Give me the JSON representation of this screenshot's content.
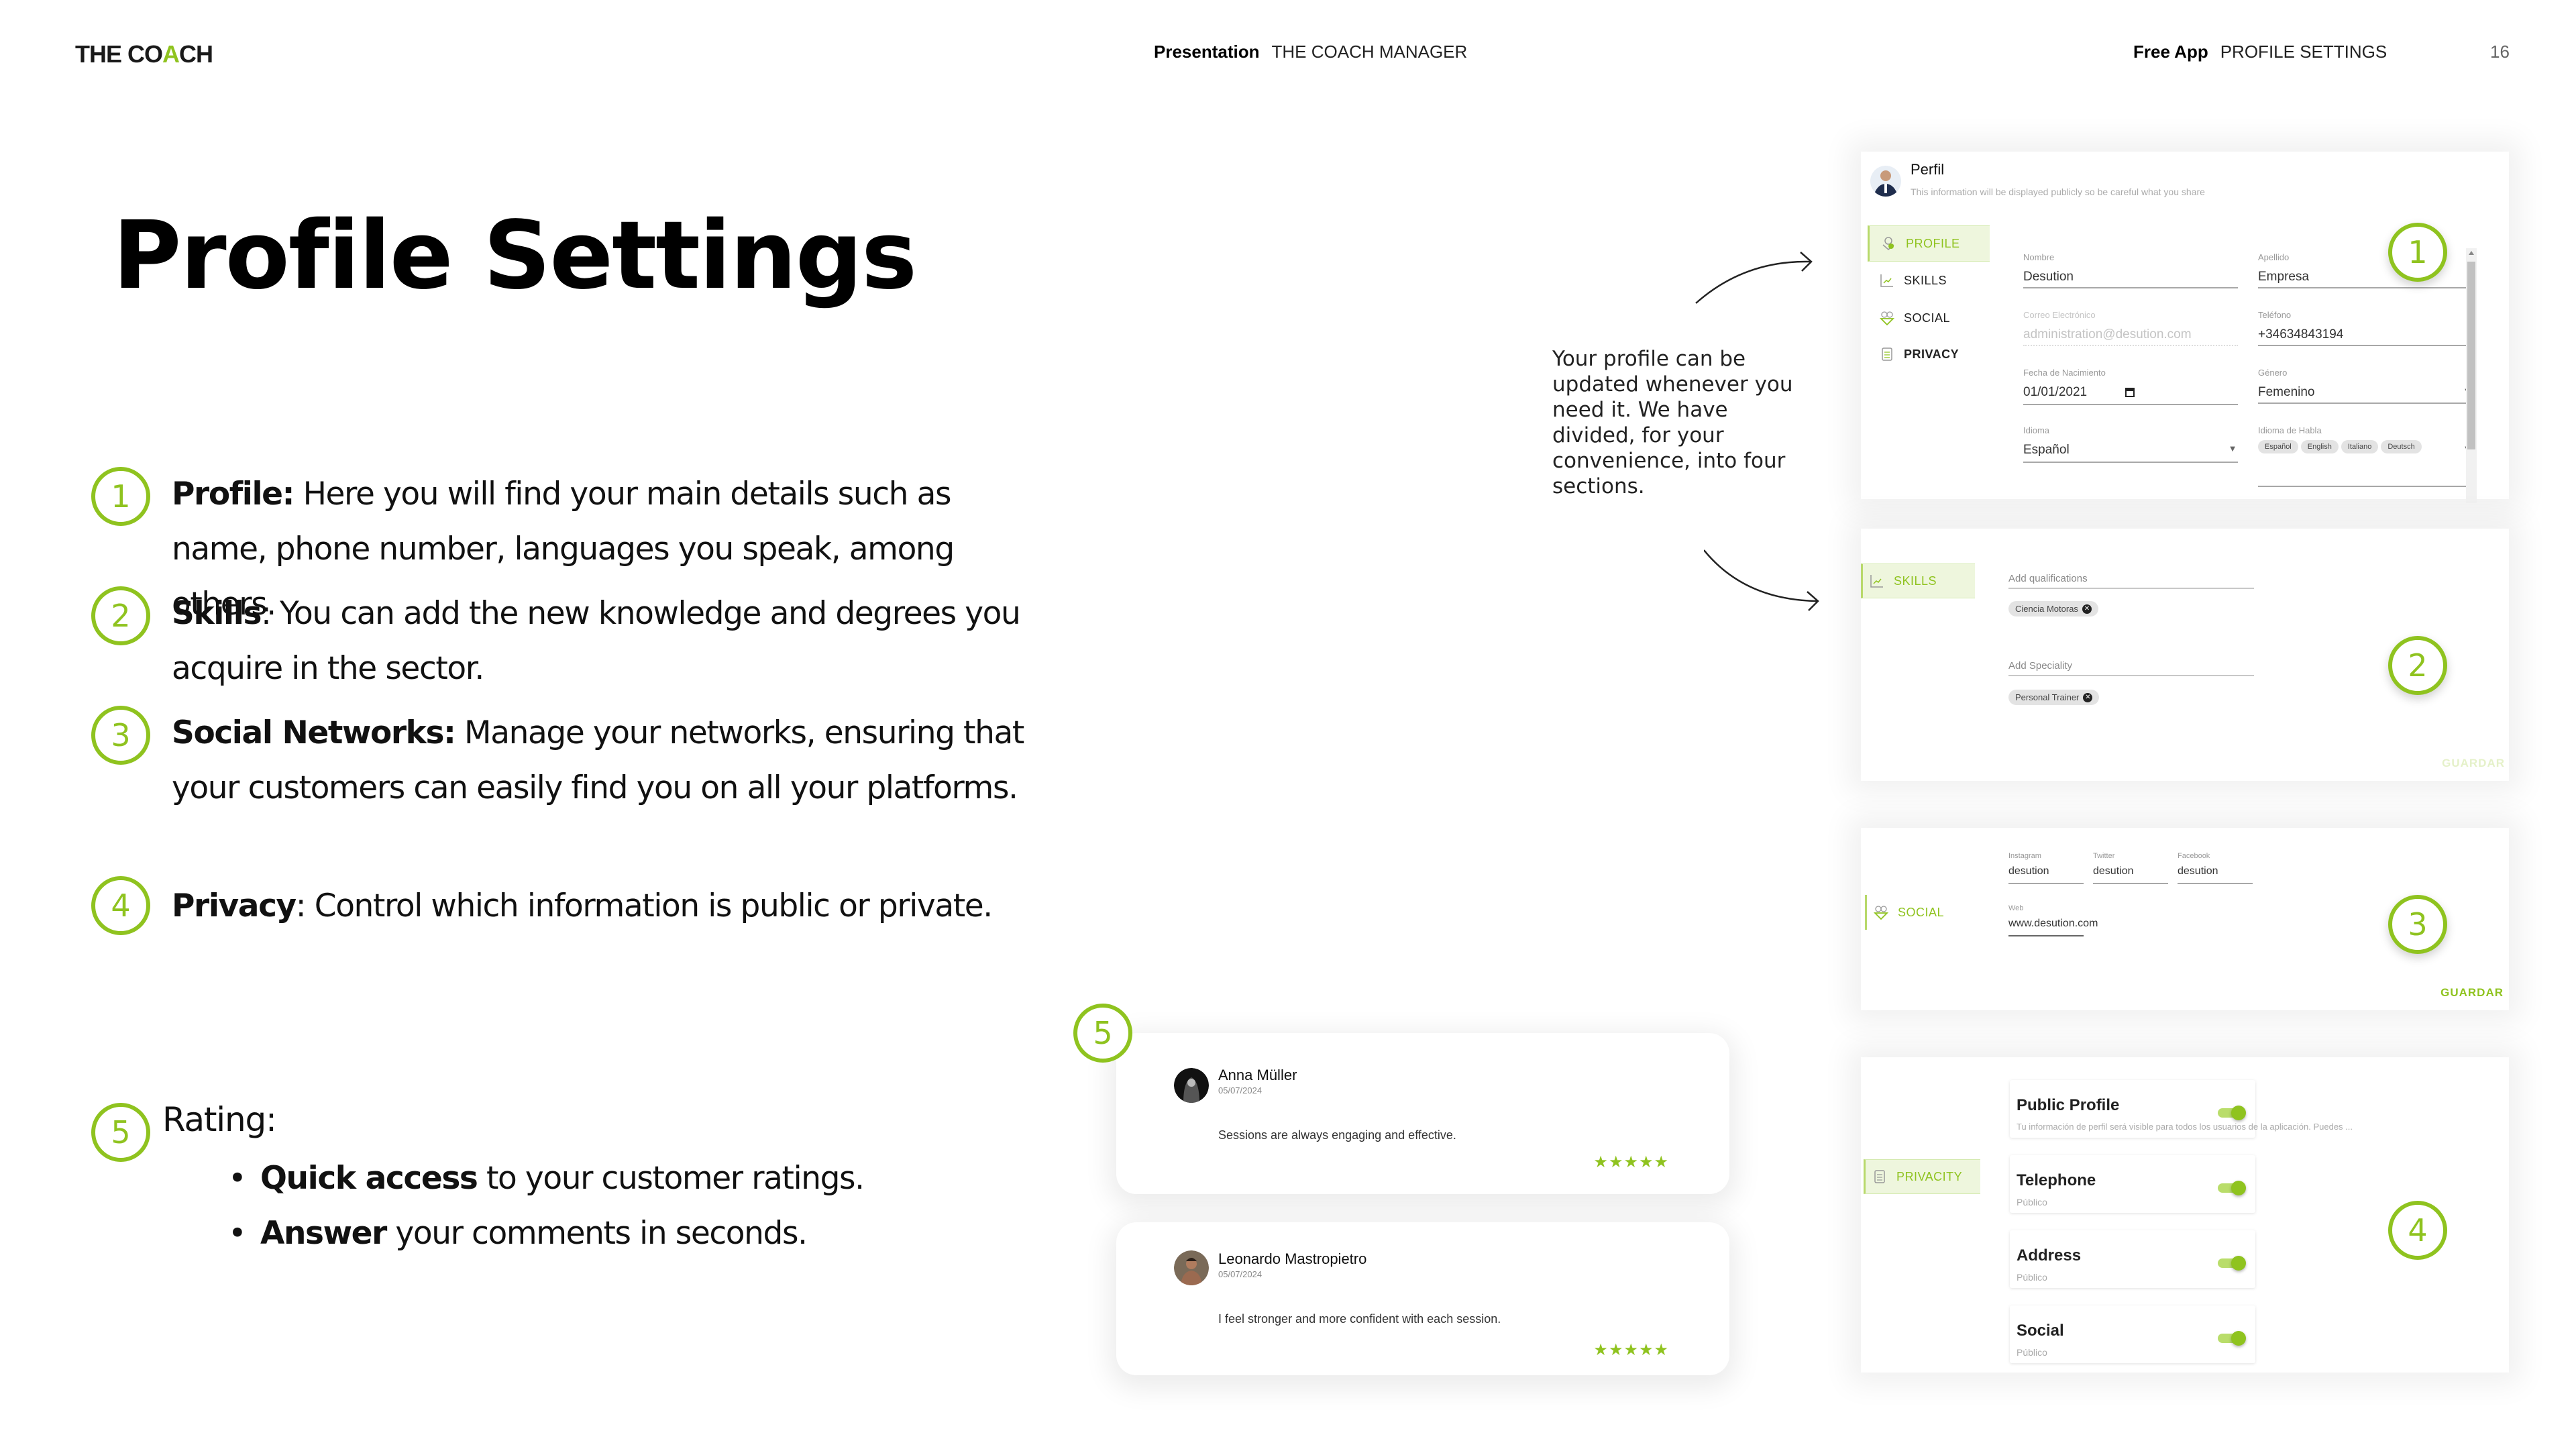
{
  "header": {
    "logo": {
      "pre": "THE CO",
      "accent": "A",
      "post": "CH"
    },
    "presentation_label": "Presentation",
    "presentation_value": "THE COACH MANAGER",
    "section_label": "Free App",
    "section_value": "PROFILE SETTINGS",
    "page_number": "16"
  },
  "title": "Profile Settings",
  "accent_color": "#8fc31f",
  "items": [
    {
      "num": "1",
      "bold": "Profile:",
      "text": " Here you will find your main details such as name, phone number, languages you speak, among others."
    },
    {
      "num": "2",
      "bold": "Skills",
      "text": ": You can add the new knowledge and degrees you acquire in the sector."
    },
    {
      "num": "3",
      "bold": "Social Networks:",
      "text": " Manage your networks, ensuring that your customers can easily find you on all your platforms."
    },
    {
      "num": "4",
      "bold": "Privacy",
      "text": ": Control which information is public or private."
    }
  ],
  "rating": {
    "num": "5",
    "title": "Rating:",
    "bullets": [
      {
        "bold": "Quick access",
        "text": " to your customer ratings."
      },
      {
        "bold": "Answer",
        "text": " your comments in seconds."
      }
    ]
  },
  "callout": "Your profile can be updated whenever you need it. We have divided, for your convenience, into four sections.",
  "profile_panel": {
    "title": "Perfil",
    "subtitle": "This information will be displayed publicly so be careful what you share",
    "nav": [
      "PROFILE",
      "SKILLS",
      "SOCIAL",
      "PRIVACY"
    ],
    "fields": {
      "nombre": {
        "label": "Nombre",
        "value": "Desution"
      },
      "apellido": {
        "label": "Apellido",
        "value": "Empresa"
      },
      "correo": {
        "label": "Correo Electrónico",
        "value": "administration@desution.com"
      },
      "telefono": {
        "label": "Teléfono",
        "value": "+34634843194"
      },
      "fecha": {
        "label": "Fecha de Nacimiento",
        "value": "01/01/2021"
      },
      "genero": {
        "label": "Género",
        "value": "Femenino"
      },
      "idioma": {
        "label": "Idioma",
        "value": "Español"
      },
      "idioma_habla": {
        "label": "Idioma de Habla",
        "chips": [
          "Español",
          "English",
          "Italiano",
          "Deutsch"
        ]
      }
    },
    "badge": "1"
  },
  "skills_panel": {
    "nav": "SKILLS",
    "qualifications_label": "Add qualifications",
    "qualifications": [
      "Ciencia Motoras"
    ],
    "speciality_label": "Add Speciality",
    "specialities": [
      "Personal Trainer"
    ],
    "save": "GUARDAR",
    "badge": "2"
  },
  "social_panel": {
    "nav": "SOCIAL",
    "fields": {
      "instagram": {
        "label": "Instagram",
        "value": "desution"
      },
      "twitter": {
        "label": "Twitter",
        "value": "desution"
      },
      "facebook": {
        "label": "Facebook",
        "value": "desution"
      },
      "web": {
        "label": "Web",
        "value": "www.desution.com"
      }
    },
    "save": "GUARDAR",
    "badge": "3"
  },
  "privacy_panel": {
    "nav": "PRIVACITY",
    "settings": [
      {
        "title": "Public Profile",
        "subtitle": "Tu información de perfil será visible para todos los usuarios de la aplicación. Puedes ...",
        "enabled": true
      },
      {
        "title": "Telephone",
        "subtitle": "Público",
        "enabled": true
      },
      {
        "title": "Address",
        "subtitle": "Público",
        "enabled": true
      },
      {
        "title": "Social",
        "subtitle": "Público",
        "enabled": true
      }
    ],
    "badge": "4"
  },
  "reviews": {
    "badge": "5",
    "items": [
      {
        "name": "Anna Müller",
        "date": "05/07/2024",
        "comment": "Sessions are always engaging and effective.",
        "stars": "★★★★★",
        "rating": 5
      },
      {
        "name": "Leonardo Mastropietro",
        "date": "05/07/2024",
        "comment": "I feel stronger and more confident with each session.",
        "stars": "★★★★★",
        "rating": 5
      }
    ]
  }
}
